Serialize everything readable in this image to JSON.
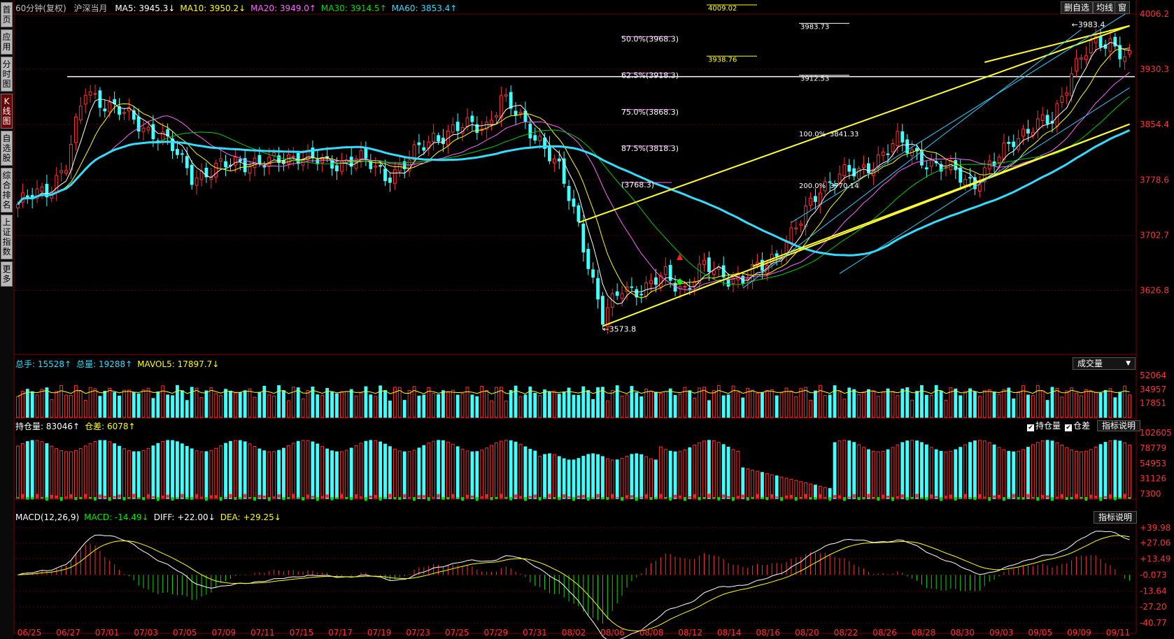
{
  "sidebar": {
    "items": [
      {
        "label": "首页",
        "active": false
      },
      {
        "label": "应用",
        "active": false
      },
      {
        "label": "分时图",
        "active": false
      },
      {
        "label": "K线图",
        "active": true
      },
      {
        "label": "自选股",
        "active": false
      },
      {
        "label": "综合排名",
        "active": false
      },
      {
        "label": "上证指数",
        "active": false
      },
      {
        "label": "更多",
        "active": false
      }
    ]
  },
  "header": {
    "period": "60分钟(复权)",
    "symbol": "沪深当月",
    "ma": [
      {
        "text": "MA5: 3945.3↓",
        "color": "#ffffff"
      },
      {
        "text": "MA10: 3950.2↓",
        "color": "#ffff00"
      },
      {
        "text": "MA20: 3949.0↑",
        "color": "#ff66ff"
      },
      {
        "text": "MA30: 3914.5↑",
        "color": "#00dd00"
      },
      {
        "text": "MA60: 3853.4↑",
        "color": "#33ddff"
      }
    ],
    "buttons": [
      "删自选",
      "均线",
      "窗"
    ]
  },
  "volume_header": [
    {
      "text": "总手: 15528↑",
      "color": "#33ddff"
    },
    {
      "text": "总量: 19288↑",
      "color": "#33ddff"
    },
    {
      "text": "MAVOL5: 17897.7↓",
      "color": "#ffff00"
    }
  ],
  "volume_dropdown": "成交量",
  "oi_header": [
    {
      "text": "持仓量: 83046↑",
      "color": "#ffffff"
    },
    {
      "text": "仓差: 6078↑",
      "color": "#ffff00"
    }
  ],
  "oi_checks": [
    "持仓量",
    "仓差"
  ],
  "oi_button": "指标说明",
  "macd_header": [
    {
      "text": "MACD(12,26,9)",
      "color": "#ffffff"
    },
    {
      "text": "MACD: -14.49↓",
      "color": "#00ee00"
    },
    {
      "text": "DIFF: +22.00↓",
      "color": "#ffffff"
    },
    {
      "text": "DEA: +29.25↓",
      "color": "#ffff00"
    }
  ],
  "macd_button": "指标说明",
  "chart_data": {
    "type": "candlestick",
    "price_axis": {
      "ticks": [
        "4006.2",
        "3930.3",
        "3854.4",
        "3778.6",
        "3702.7",
        "3626.8"
      ],
      "range": [
        3540,
        4006.2
      ]
    },
    "volume_axis": {
      "ticks": [
        "52064",
        "34957",
        "17851"
      ],
      "range": [
        0,
        60000
      ]
    },
    "oi_axis": {
      "ticks": [
        "102605",
        "78779",
        "54953",
        "31126",
        "7300"
      ],
      "range": [
        0,
        105000
      ]
    },
    "macd_axis": {
      "ticks": [
        "+39.98",
        "+27.06",
        "+13.49",
        "-0.073",
        "-13.64",
        "-27.20",
        "-40.77"
      ],
      "range": [
        -46,
        44
      ]
    },
    "dates": [
      "06/25",
      "06/27",
      "07/01",
      "07/03",
      "07/05",
      "07/09",
      "07/11",
      "07/15",
      "07/17",
      "07/19",
      "07/23",
      "07/25",
      "07/29",
      "07/31",
      "08/02",
      "08/06",
      "08/08",
      "08/12",
      "08/14",
      "08/16",
      "08/20",
      "08/22",
      "08/26",
      "08/28",
      "08/30",
      "09/03",
      "09/05",
      "09/09",
      "09/11"
    ],
    "close_keypoints": [
      [
        0,
        3745
      ],
      [
        6,
        3765
      ],
      [
        10,
        3800
      ],
      [
        14,
        3900
      ],
      [
        20,
        3878
      ],
      [
        24,
        3858
      ],
      [
        30,
        3838
      ],
      [
        36,
        3785
      ],
      [
        40,
        3790
      ],
      [
        46,
        3805
      ],
      [
        52,
        3800
      ],
      [
        58,
        3815
      ],
      [
        64,
        3798
      ],
      [
        70,
        3810
      ],
      [
        76,
        3785
      ],
      [
        80,
        3800
      ],
      [
        86,
        3838
      ],
      [
        92,
        3850
      ],
      [
        97,
        3855
      ],
      [
        100,
        3890
      ],
      [
        104,
        3862
      ],
      [
        108,
        3835
      ],
      [
        112,
        3790
      ],
      [
        116,
        3720
      ],
      [
        121,
        3585
      ],
      [
        125,
        3632
      ],
      [
        130,
        3628
      ],
      [
        134,
        3648
      ],
      [
        138,
        3630
      ],
      [
        142,
        3658
      ],
      [
        146,
        3650
      ],
      [
        150,
        3640
      ],
      [
        154,
        3660
      ],
      [
        158,
        3685
      ],
      [
        162,
        3720
      ],
      [
        166,
        3770
      ],
      [
        170,
        3785
      ],
      [
        174,
        3788
      ],
      [
        178,
        3810
      ],
      [
        182,
        3830
      ],
      [
        186,
        3815
      ],
      [
        190,
        3795
      ],
      [
        194,
        3790
      ],
      [
        198,
        3775
      ],
      [
        202,
        3800
      ],
      [
        206,
        3838
      ],
      [
        210,
        3850
      ],
      [
        214,
        3860
      ],
      [
        218,
        3930
      ],
      [
        222,
        3960
      ],
      [
        226,
        3970
      ],
      [
        230,
        3945
      ]
    ],
    "price_levels": [
      {
        "label": "4009.02",
        "value": 4009.02
      },
      {
        "label": "3983.73",
        "value": 3983.73
      },
      {
        "label": "3938.76",
        "value": 3938.76
      },
      {
        "label": "3912.53",
        "value": 3912.53
      }
    ],
    "fib_labels": [
      {
        "label": "50.0%(3968.3)",
        "value": 3968.3
      },
      {
        "label": "62.5%(3918.3)",
        "value": 3918.3
      },
      {
        "label": "75.0%(3868.3)",
        "value": 3868.3
      },
      {
        "label": "87.5%(3818.3)",
        "value": 3818.3
      },
      {
        "label": "(3768.3)",
        "value": 3768.3
      }
    ],
    "extension_labels": [
      {
        "label": "100.0%",
        "value": 3841.33
      },
      {
        "label": "3841.33",
        "value": 3841.33
      },
      {
        "label": "200.0%",
        "value": 3770.14
      },
      {
        "label": "3770.14",
        "value": 3770.14
      }
    ],
    "high_label": "3983.4",
    "low_label": "3573.8",
    "horizontal_line": 3918.3
  }
}
